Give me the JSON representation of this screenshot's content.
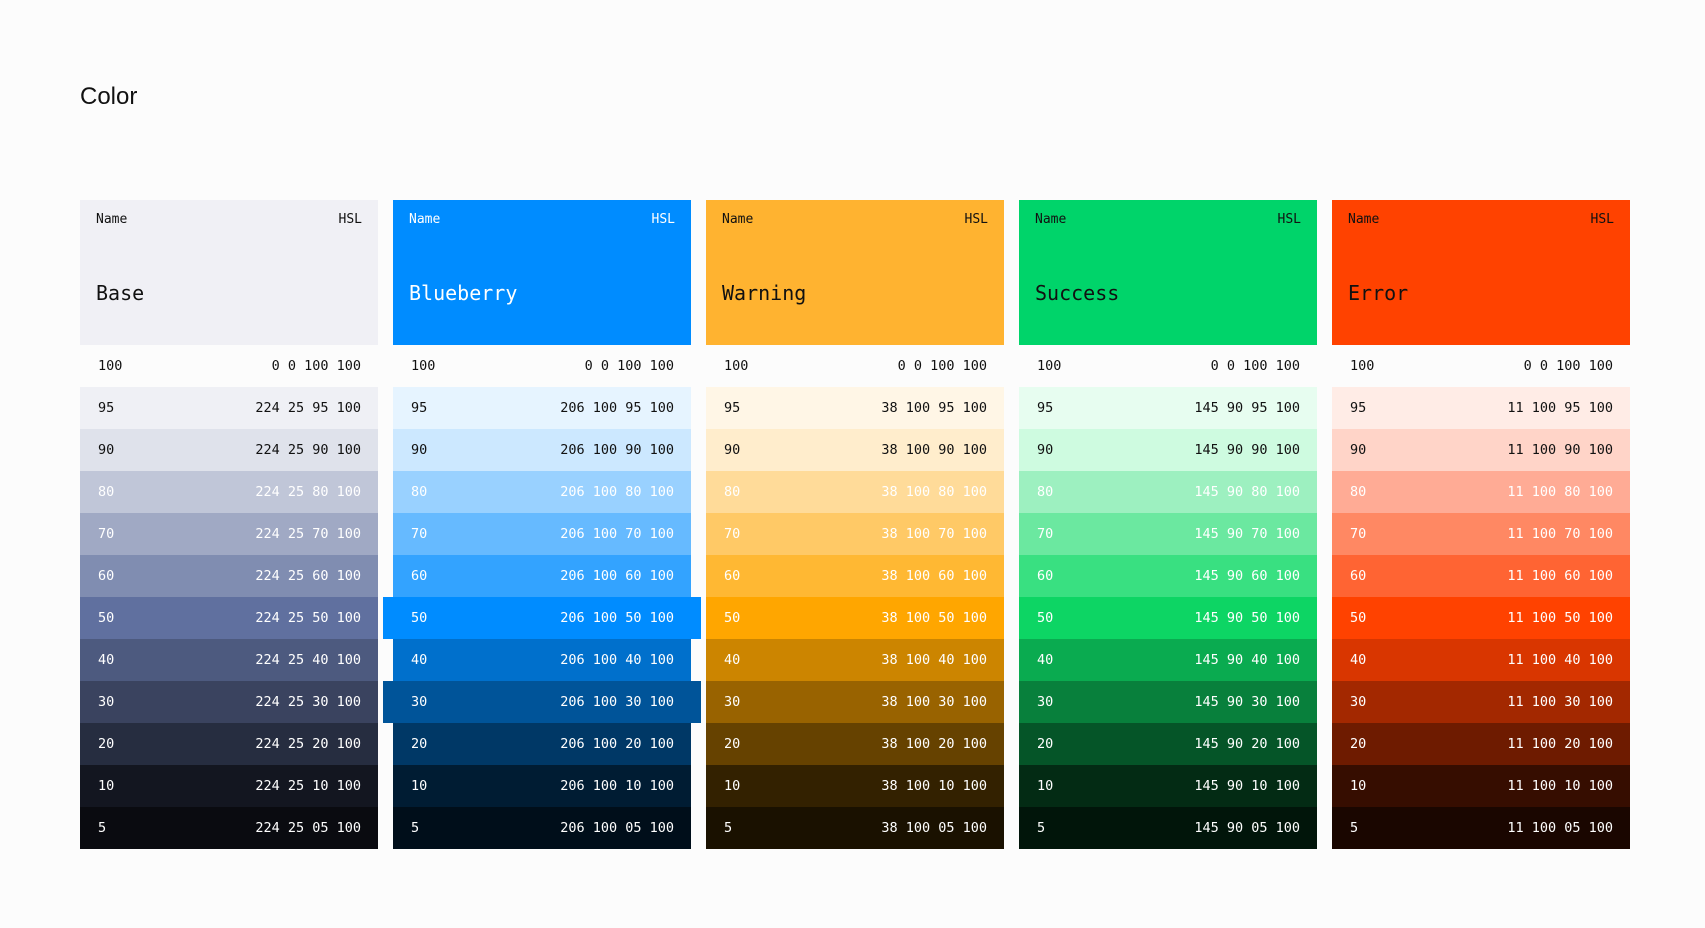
{
  "title": "Color",
  "header": {
    "name_label": "Name",
    "hsl_label": "HSL"
  },
  "palettes": [
    {
      "name": "Base",
      "header_bg": "#f0f0f5",
      "header_fg": "#111111",
      "swatches": [
        {
          "level": "100",
          "value": "0 0 100 100",
          "bg": "#ffffff",
          "fg": "#111111"
        },
        {
          "level": "95",
          "value": "224 25 95 100",
          "bg": "#eff0f5",
          "fg": "#111111"
        },
        {
          "level": "90",
          "value": "224 25 90 100",
          "bg": "#dfe2eb",
          "fg": "#111111"
        },
        {
          "level": "80",
          "value": "224 25 80 100",
          "bg": "#c0c6d8",
          "fg": "#ffffff"
        },
        {
          "level": "70",
          "value": "224 25 70 100",
          "bg": "#a0a9c4",
          "fg": "#ffffff"
        },
        {
          "level": "60",
          "value": "224 25 60 100",
          "bg": "#808db1",
          "fg": "#ffffff"
        },
        {
          "level": "50",
          "value": "224 25 50 100",
          "bg": "#60709f",
          "fg": "#ffffff"
        },
        {
          "level": "40",
          "value": "224 25 40 100",
          "bg": "#4d5a7f",
          "fg": "#ffffff"
        },
        {
          "level": "30",
          "value": "224 25 30 100",
          "bg": "#3a435f",
          "fg": "#ffffff"
        },
        {
          "level": "20",
          "value": "224 25 20 100",
          "bg": "#262d40",
          "fg": "#ffffff"
        },
        {
          "level": "10",
          "value": "224 25 10 100",
          "bg": "#131620",
          "fg": "#ffffff"
        },
        {
          "level": "5",
          "value": "224 25 05 100",
          "bg": "#0a0b10",
          "fg": "#ffffff"
        }
      ]
    },
    {
      "name": "Blueberry",
      "header_bg": "#008cff",
      "header_fg": "#ffffff",
      "swatches": [
        {
          "level": "100",
          "value": "0 0 100 100",
          "bg": "#ffffff",
          "fg": "#111111"
        },
        {
          "level": "95",
          "value": "206 100 95 100",
          "bg": "#e6f4ff",
          "fg": "#111111"
        },
        {
          "level": "90",
          "value": "206 100 90 100",
          "bg": "#cce8ff",
          "fg": "#111111"
        },
        {
          "level": "80",
          "value": "206 100 80 100",
          "bg": "#99d1ff",
          "fg": "#ffffff"
        },
        {
          "level": "70",
          "value": "206 100 70 100",
          "bg": "#66baff",
          "fg": "#ffffff"
        },
        {
          "level": "60",
          "value": "206 100 60 100",
          "bg": "#33a3ff",
          "fg": "#ffffff"
        },
        {
          "level": "50",
          "value": "206 100 50 100",
          "bg": "#008cff",
          "fg": "#ffffff",
          "pop": true
        },
        {
          "level": "40",
          "value": "206 100 40 100",
          "bg": "#0070cc",
          "fg": "#ffffff"
        },
        {
          "level": "30",
          "value": "206 100 30 100",
          "bg": "#005499",
          "fg": "#ffffff",
          "pop": true
        },
        {
          "level": "20",
          "value": "206 100 20 100",
          "bg": "#003866",
          "fg": "#ffffff"
        },
        {
          "level": "10",
          "value": "206 100 10 100",
          "bg": "#001c33",
          "fg": "#ffffff"
        },
        {
          "level": "5",
          "value": "206 100 05 100",
          "bg": "#000e1a",
          "fg": "#ffffff"
        }
      ]
    },
    {
      "name": "Warning",
      "header_bg": "#ffb330",
      "header_fg": "#111111",
      "swatches": [
        {
          "level": "100",
          "value": "0 0 100 100",
          "bg": "#ffffff",
          "fg": "#111111"
        },
        {
          "level": "95",
          "value": "38 100 95 100",
          "bg": "#fff6e6",
          "fg": "#111111"
        },
        {
          "level": "90",
          "value": "38 100 90 100",
          "bg": "#ffedcc",
          "fg": "#111111"
        },
        {
          "level": "80",
          "value": "38 100 80 100",
          "bg": "#ffdb99",
          "fg": "#ffffff"
        },
        {
          "level": "70",
          "value": "38 100 70 100",
          "bg": "#ffc966",
          "fg": "#ffffff"
        },
        {
          "level": "60",
          "value": "38 100 60 100",
          "bg": "#ffb833",
          "fg": "#ffffff"
        },
        {
          "level": "50",
          "value": "38 100 50 100",
          "bg": "#ffa600",
          "fg": "#ffffff"
        },
        {
          "level": "40",
          "value": "38 100 40 100",
          "bg": "#cc8500",
          "fg": "#ffffff"
        },
        {
          "level": "30",
          "value": "38 100 30 100",
          "bg": "#996300",
          "fg": "#ffffff"
        },
        {
          "level": "20",
          "value": "38 100 20 100",
          "bg": "#664200",
          "fg": "#ffffff"
        },
        {
          "level": "10",
          "value": "38 100 10 100",
          "bg": "#332100",
          "fg": "#ffffff"
        },
        {
          "level": "5",
          "value": "38 100 05 100",
          "bg": "#1a1100",
          "fg": "#ffffff"
        }
      ]
    },
    {
      "name": "Success",
      "header_bg": "#00d46a",
      "header_fg": "#111111",
      "swatches": [
        {
          "level": "100",
          "value": "0 0 100 100",
          "bg": "#ffffff",
          "fg": "#111111"
        },
        {
          "level": "95",
          "value": "145 90 95 100",
          "bg": "#e7fdf0",
          "fg": "#111111"
        },
        {
          "level": "90",
          "value": "145 90 90 100",
          "bg": "#cefbe0",
          "fg": "#111111"
        },
        {
          "level": "80",
          "value": "145 90 80 100",
          "bg": "#9df0c0",
          "fg": "#ffffff"
        },
        {
          "level": "70",
          "value": "145 90 70 100",
          "bg": "#6be8a0",
          "fg": "#ffffff"
        },
        {
          "level": "60",
          "value": "145 90 60 100",
          "bg": "#39e081",
          "fg": "#ffffff"
        },
        {
          "level": "50",
          "value": "145 90 50 100",
          "bg": "#0dd564",
          "fg": "#ffffff"
        },
        {
          "level": "40",
          "value": "145 90 40 100",
          "bg": "#0aab50",
          "fg": "#ffffff"
        },
        {
          "level": "30",
          "value": "145 90 30 100",
          "bg": "#08803c",
          "fg": "#ffffff"
        },
        {
          "level": "20",
          "value": "145 90 20 100",
          "bg": "#055528",
          "fg": "#ffffff"
        },
        {
          "level": "10",
          "value": "145 90 10 100",
          "bg": "#032b14",
          "fg": "#ffffff"
        },
        {
          "level": "5",
          "value": "145 90 05 100",
          "bg": "#01150a",
          "fg": "#ffffff"
        }
      ]
    },
    {
      "name": "Error",
      "header_bg": "#ff4200",
      "header_fg": "#111111",
      "swatches": [
        {
          "level": "100",
          "value": "0 0 100 100",
          "bg": "#ffffff",
          "fg": "#111111"
        },
        {
          "level": "95",
          "value": "11 100 95 100",
          "bg": "#ffece6",
          "fg": "#111111"
        },
        {
          "level": "90",
          "value": "11 100 90 100",
          "bg": "#ffd4c8",
          "fg": "#111111"
        },
        {
          "level": "80",
          "value": "11 100 80 100",
          "bg": "#ffab95",
          "fg": "#ffffff"
        },
        {
          "level": "70",
          "value": "11 100 70 100",
          "bg": "#ff8863",
          "fg": "#ffffff"
        },
        {
          "level": "60",
          "value": "11 100 60 100",
          "bg": "#ff6433",
          "fg": "#ffffff"
        },
        {
          "level": "50",
          "value": "11 100 50 100",
          "bg": "#ff4200",
          "fg": "#ffffff"
        },
        {
          "level": "40",
          "value": "11 100 40 100",
          "bg": "#d93600",
          "fg": "#ffffff"
        },
        {
          "level": "30",
          "value": "11 100 30 100",
          "bg": "#a32800",
          "fg": "#ffffff"
        },
        {
          "level": "20",
          "value": "11 100 20 100",
          "bg": "#6e1b00",
          "fg": "#ffffff"
        },
        {
          "level": "10",
          "value": "11 100 10 100",
          "bg": "#360d00",
          "fg": "#ffffff"
        },
        {
          "level": "5",
          "value": "11 100 05 100",
          "bg": "#1a0600",
          "fg": "#ffffff"
        }
      ]
    }
  ]
}
